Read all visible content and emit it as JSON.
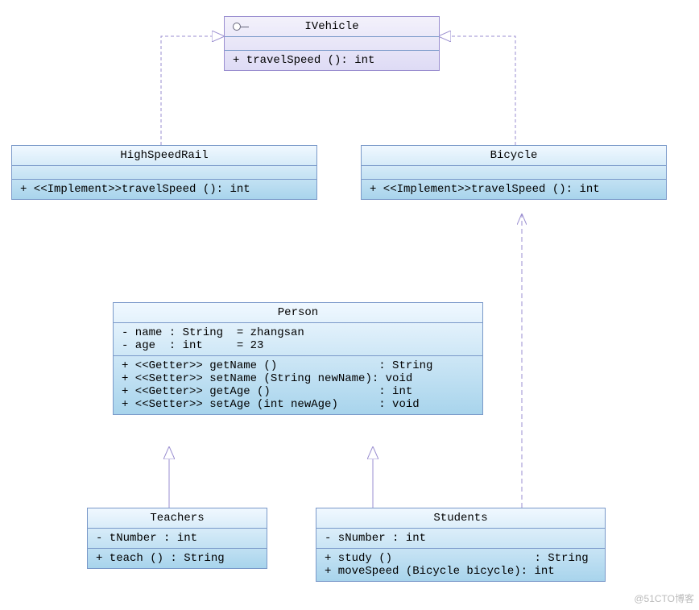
{
  "diagram": {
    "ivehicle": {
      "name": "IVehicle",
      "methods": "+ travelSpeed (): int"
    },
    "highspeedrail": {
      "name": "HighSpeedRail",
      "methods": "+ <<Implement>>travelSpeed (): int"
    },
    "bicycle": {
      "name": "Bicycle",
      "methods": "+ <<Implement>>travelSpeed (): int"
    },
    "person": {
      "name": "Person",
      "attrs": "- name : String  = zhangsan\n- age  : int     = 23",
      "methods": "+ <<Getter>> getName ()               : String\n+ <<Setter>> setName (String newName): void\n+ <<Getter>> getAge ()                : int\n+ <<Setter>> setAge (int newAge)      : void"
    },
    "teachers": {
      "name": "Teachers",
      "attrs": "- tNumber : int",
      "methods": "+ teach () : String"
    },
    "students": {
      "name": "Students",
      "attrs": "- sNumber : int",
      "methods": "+ study ()                     : String\n+ moveSpeed (Bicycle bicycle): int"
    }
  },
  "watermark": "@51CTO博客",
  "chart_data": {
    "type": "uml_class_diagram",
    "classes": [
      {
        "name": "IVehicle",
        "kind": "interface",
        "attributes": [],
        "operations": [
          {
            "visibility": "+",
            "name": "travelSpeed",
            "params": [],
            "return": "int"
          }
        ]
      },
      {
        "name": "HighSpeedRail",
        "kind": "class",
        "attributes": [],
        "operations": [
          {
            "visibility": "+",
            "stereotype": "Implement",
            "name": "travelSpeed",
            "params": [],
            "return": "int"
          }
        ]
      },
      {
        "name": "Bicycle",
        "kind": "class",
        "attributes": [],
        "operations": [
          {
            "visibility": "+",
            "stereotype": "Implement",
            "name": "travelSpeed",
            "params": [],
            "return": "int"
          }
        ]
      },
      {
        "name": "Person",
        "kind": "class",
        "attributes": [
          {
            "visibility": "-",
            "name": "name",
            "type": "String",
            "default": "zhangsan"
          },
          {
            "visibility": "-",
            "name": "age",
            "type": "int",
            "default": "23"
          }
        ],
        "operations": [
          {
            "visibility": "+",
            "stereotype": "Getter",
            "name": "getName",
            "params": [],
            "return": "String"
          },
          {
            "visibility": "+",
            "stereotype": "Setter",
            "name": "setName",
            "params": [
              "String newName"
            ],
            "return": "void"
          },
          {
            "visibility": "+",
            "stereotype": "Getter",
            "name": "getAge",
            "params": [],
            "return": "int"
          },
          {
            "visibility": "+",
            "stereotype": "Setter",
            "name": "setAge",
            "params": [
              "int newAge"
            ],
            "return": "void"
          }
        ]
      },
      {
        "name": "Teachers",
        "kind": "class",
        "attributes": [
          {
            "visibility": "-",
            "name": "tNumber",
            "type": "int"
          }
        ],
        "operations": [
          {
            "visibility": "+",
            "name": "teach",
            "params": [],
            "return": "String"
          }
        ]
      },
      {
        "name": "Students",
        "kind": "class",
        "attributes": [
          {
            "visibility": "-",
            "name": "sNumber",
            "type": "int"
          }
        ],
        "operations": [
          {
            "visibility": "+",
            "name": "study",
            "params": [],
            "return": "String"
          },
          {
            "visibility": "+",
            "name": "moveSpeed",
            "params": [
              "Bicycle bicycle"
            ],
            "return": "int"
          }
        ]
      }
    ],
    "relationships": [
      {
        "from": "HighSpeedRail",
        "to": "IVehicle",
        "type": "realization"
      },
      {
        "from": "Bicycle",
        "to": "IVehicle",
        "type": "realization"
      },
      {
        "from": "Teachers",
        "to": "Person",
        "type": "generalization"
      },
      {
        "from": "Students",
        "to": "Person",
        "type": "generalization"
      },
      {
        "from": "Students",
        "to": "Bicycle",
        "type": "dependency"
      }
    ]
  }
}
